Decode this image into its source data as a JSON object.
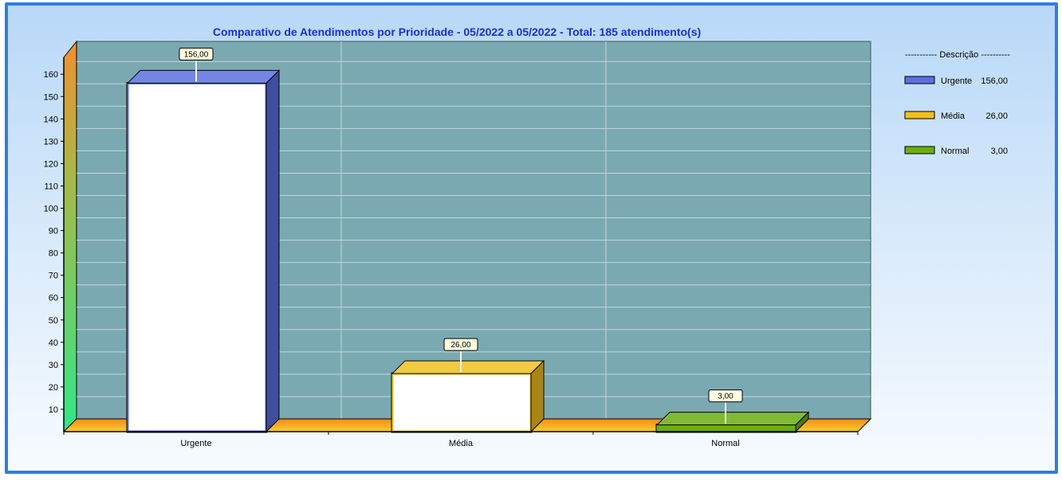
{
  "chart_data": {
    "type": "bar",
    "title": "Comparativo de Atendimentos por Prioridade  - 05/2022 a 05/2022 - Total: 185 atendimento(s)",
    "categories": [
      "Urgente",
      "Média",
      "Normal"
    ],
    "values": [
      156,
      26,
      3
    ],
    "value_labels": [
      "156,00",
      "26,00",
      "3,00"
    ],
    "colors": [
      "#5b6fe0",
      "#f0c020",
      "#6aae10"
    ],
    "ylim": [
      0,
      170
    ],
    "yticks": [
      10,
      20,
      30,
      40,
      50,
      60,
      70,
      80,
      90,
      100,
      110,
      120,
      130,
      140,
      150,
      160
    ],
    "grid": true,
    "legend": {
      "placement": "right",
      "header": "----------- Descrição ----------",
      "entries": [
        {
          "label": "Urgente",
          "value": "156,00"
        },
        {
          "label": "Média",
          "value": "26,00"
        },
        {
          "label": "Normal",
          "value": "3,00"
        }
      ]
    },
    "colors_style": {
      "plot_background": "#7aa9b1",
      "floor": "#f4a020",
      "frame": "#2f7fe0"
    }
  }
}
